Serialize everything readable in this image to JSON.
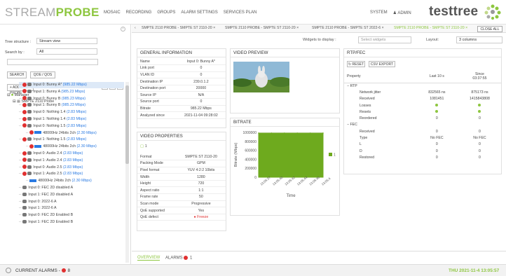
{
  "header": {
    "brand_a": "STREAM",
    "brand_b": "PROBE",
    "nav": [
      "MOSAIC",
      "RECORDING",
      "GROUPS",
      "ALARM SETTINGS",
      "SERVICES PLAN"
    ],
    "system": "SYSTEM",
    "admin": "ADMIN",
    "logo": "testtree"
  },
  "left": {
    "tree_structure_label": "Tree structure :",
    "tree_structure_value": "Stream view",
    "search_by_label": "Search by :",
    "search_by_value": "All",
    "search_btn": "SEARCH",
    "qoe_btn": "QOE / QOS",
    "add_probe": "+ ADD PROBE",
    "manager": "Manager",
    "probe": "SMPTE 2110 Probe"
  },
  "tree": [
    {
      "label": "Input 0: Bunny A* ",
      "rate": "(985.22 Mbps)",
      "err": true,
      "sel": true,
      "indent": 1
    },
    {
      "label": "Input 1: Bunny A ",
      "rate": "(985.23 Mbps)",
      "err": true,
      "indent": 1
    },
    {
      "label": "Input 0: Bunny B ",
      "rate": "(985.23 Mbps)",
      "err": true,
      "indent": 1
    },
    {
      "label": "Input 1: Bunny B ",
      "rate": "(985.23 Mbps)",
      "err": true,
      "indent": 1
    },
    {
      "label": "Input 0: Nothing 1.4 ",
      "rate": "(2.83 Mbps)",
      "err": true,
      "indent": 1
    },
    {
      "label": "Input 1: Nothing 1.4 ",
      "rate": "(2.83 Mbps)",
      "err": true,
      "indent": 1
    },
    {
      "label": "Input 0: Nothing 1.5 ",
      "rate": "(2.83 Mbps)",
      "err": true,
      "indent": 1
    },
    {
      "label": "48000Hz 24bits 2ch ",
      "rate": "(2.30 Mbps)",
      "err": true,
      "vid": true,
      "indent": 2
    },
    {
      "label": "Input 1: Nothing 1.5 ",
      "rate": "(2.83 Mbps)",
      "err": true,
      "indent": 1
    },
    {
      "label": "48000Hz 24bits 2ch ",
      "rate": "(2.30 Mbps)",
      "err": true,
      "vid": true,
      "indent": 2
    },
    {
      "label": "Input 0: Audio 2.4 ",
      "rate": "(2.83 Mbps)",
      "err": true,
      "indent": 1
    },
    {
      "label": "Input 1: Audio 2.4 ",
      "rate": "(2.83 Mbps)",
      "err": true,
      "indent": 1
    },
    {
      "label": "Input 0: Audio 2.5 ",
      "rate": "(2.83 Mbps)",
      "err": true,
      "indent": 1
    },
    {
      "label": "Input 1: Audio 2.5 ",
      "rate": "(2.83 Mbps)",
      "err": true,
      "indent": 1
    },
    {
      "label": "48000Hz 24bits 2ch ",
      "rate": "(2.30 Mbps)",
      "vid": true,
      "indent": 2
    },
    {
      "label": "Input 0: FEC 2D disabled A",
      "rate": "",
      "indent": 1
    },
    {
      "label": "Input 1: FEC 2D disabled A",
      "rate": "",
      "indent": 1
    },
    {
      "label": "Input 0: 2022-6 A",
      "rate": "",
      "indent": 1
    },
    {
      "label": "Input 1: 2022-6 A",
      "rate": "",
      "indent": 1
    },
    {
      "label": "Input 0: FEC 2D Enabled B",
      "rate": "",
      "indent": 1
    },
    {
      "label": "Input 1: FEC 2D Enabled B",
      "rate": "",
      "indent": 1
    }
  ],
  "tabs": [
    {
      "label": "SMPTE 2110 PROBE - SMPTE ST 2110-20"
    },
    {
      "label": "SMPTE 2110 PROBE - SMPTE ST 2110-20"
    },
    {
      "label": "SMPTE 2110 PROBE - SMPTE ST 2022-6"
    },
    {
      "label": "SMPTE 2110 PROBE - SMPTE ST 2110-20",
      "active": true
    }
  ],
  "close_all": "CLOSE ALL",
  "widgets": {
    "label": "Widgets to display :",
    "placeholder": "Select widgets",
    "layout_label": "Layout:",
    "layout_value": "3 columns"
  },
  "general_info": {
    "title": "GENERAL INFORMATION",
    "rows": [
      [
        "Name",
        "Input 0: Bunny A*"
      ],
      [
        "Link port",
        "0"
      ],
      [
        "VLAN ID",
        "0"
      ],
      [
        "Destination IP",
        "239.0.1.2"
      ],
      [
        "Destination port",
        "20000"
      ],
      [
        "Source IP",
        "N/A"
      ],
      [
        "Source port",
        "0"
      ],
      [
        "Bitrate",
        "985.22 Mbps"
      ],
      [
        "Analyzed since",
        "2021-11-04 09:28:02"
      ]
    ]
  },
  "video_props": {
    "title": "VIDEO PROPERTIES",
    "count": "1",
    "rows": [
      [
        "Format",
        "SMPTE ST 2110-20"
      ],
      [
        "Packing Mode",
        "GPM"
      ],
      [
        "Pixel format",
        "YUV 4:2:2 10bits"
      ],
      [
        "Width",
        "1280"
      ],
      [
        "Height",
        "720"
      ],
      [
        "Aspect ratio",
        "1:1"
      ],
      [
        "Frame rate",
        "50"
      ],
      [
        "Scan mode",
        "Progressive"
      ],
      [
        "QoE supported",
        "Yes"
      ],
      [
        "QoE defect",
        "Freeze"
      ]
    ]
  },
  "video_preview": {
    "title": "VIDEO PREVIEW"
  },
  "bitrate": {
    "title": "BITRATE"
  },
  "chart_data": {
    "type": "area",
    "x": [
      "13:05:37",
      "13:05:40",
      "13:05:42",
      "13:05:44",
      "13:05:46",
      "13:05:4"
    ],
    "series": [
      {
        "name": "1",
        "values": [
          985,
          985,
          985,
          985,
          985,
          985
        ]
      }
    ],
    "ylabel": "Bitrate (Mbps)",
    "xlabel": "Time",
    "ylim": [
      0,
      1000
    ],
    "yticks": [
      "1000000",
      "800000",
      "600000",
      "400000",
      "200000",
      "0"
    ],
    "legend": "1",
    "color": "#6eaa1e"
  },
  "rtp_fec": {
    "title": "RTP/FEC",
    "reset": "RESET",
    "csv": "CSV EXPORT",
    "col_property": "Property",
    "col_last": "Last 10 s",
    "col_since": "Since",
    "col_since_time": "03:37:55",
    "rows": [
      {
        "p": "RTP",
        "group": true
      },
      {
        "p": "Network jitter",
        "a": "832565 ns",
        "b": "875173 ns"
      },
      {
        "p": "Received",
        "a": "1081451",
        "b": "1415843808"
      },
      {
        "p": "Losses",
        "dot": true
      },
      {
        "p": "Resets",
        "dot": true
      },
      {
        "p": "Reordered",
        "a": "0",
        "b": "0"
      },
      {
        "p": "FEC",
        "group": true
      },
      {
        "p": "Received",
        "a": "0",
        "b": "0"
      },
      {
        "p": "Type",
        "a": "No FEC",
        "b": "No FEC"
      },
      {
        "p": "L",
        "a": "0",
        "b": "0"
      },
      {
        "p": "D",
        "a": "0",
        "b": "0"
      },
      {
        "p": "Restored",
        "a": "0",
        "b": "0"
      }
    ]
  },
  "bottom": {
    "overview": "OVERVIEW",
    "alarms": "ALARMS",
    "alarm_count": "1"
  },
  "footer": {
    "current_alarms": "CURRENT ALARMS -",
    "alarm_count": "8",
    "datetime": "THU 2021-11-4 13:05:57"
  }
}
